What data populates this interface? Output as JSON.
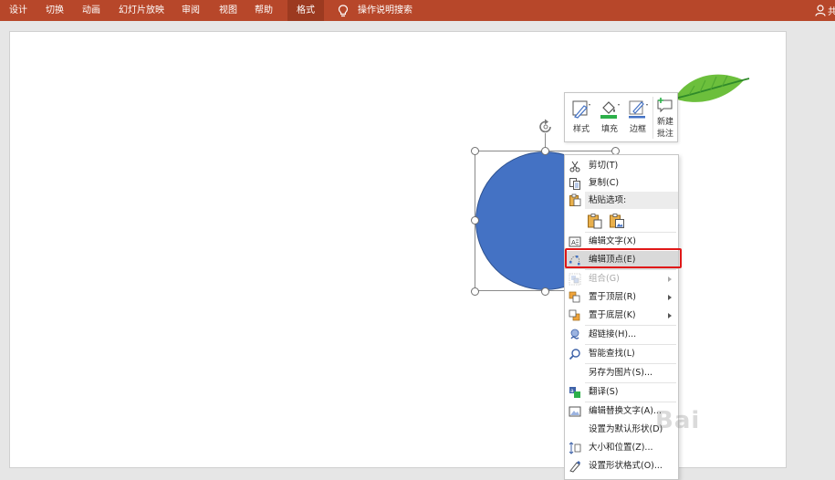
{
  "ribbon": {
    "tabs": [
      {
        "label": "设计"
      },
      {
        "label": "切换"
      },
      {
        "label": "动画"
      },
      {
        "label": "幻灯片放映"
      },
      {
        "label": "审阅"
      },
      {
        "label": "视图"
      },
      {
        "label": "帮助"
      },
      {
        "label": "格式",
        "active": true
      }
    ],
    "tell_me": "操作说明搜索",
    "account_label": "共"
  },
  "mini_toolbar": {
    "style": "样式",
    "fill": "填充",
    "outline": "边框",
    "new_comment_line1": "新建",
    "new_comment_line2": "批注"
  },
  "context_menu": {
    "cut": "剪切(T)",
    "copy": "复制(C)",
    "paste_options": "粘贴选项:",
    "edit_text": "编辑文字(X)",
    "edit_points": "编辑顶点(E)",
    "group": "组合(G)",
    "bring_to_front": "置于顶层(R)",
    "send_to_back": "置于底层(K)",
    "hyperlink": "超链接(H)...",
    "smart_lookup": "智能查找(L)",
    "save_as_picture": "另存为图片(S)...",
    "translate": "翻译(S)",
    "edit_alt_text": "编辑替换文字(A)...",
    "set_default_shape": "设置为默认形状(D)",
    "size_position": "大小和位置(Z)...",
    "format_shape": "设置形状格式(O)..."
  },
  "watermark": "Bai",
  "colors": {
    "ribbon": "#b7472a",
    "shape_fill": "#4472c4",
    "highlight_border": "#e01818",
    "leaf": "#6cbf3c"
  }
}
